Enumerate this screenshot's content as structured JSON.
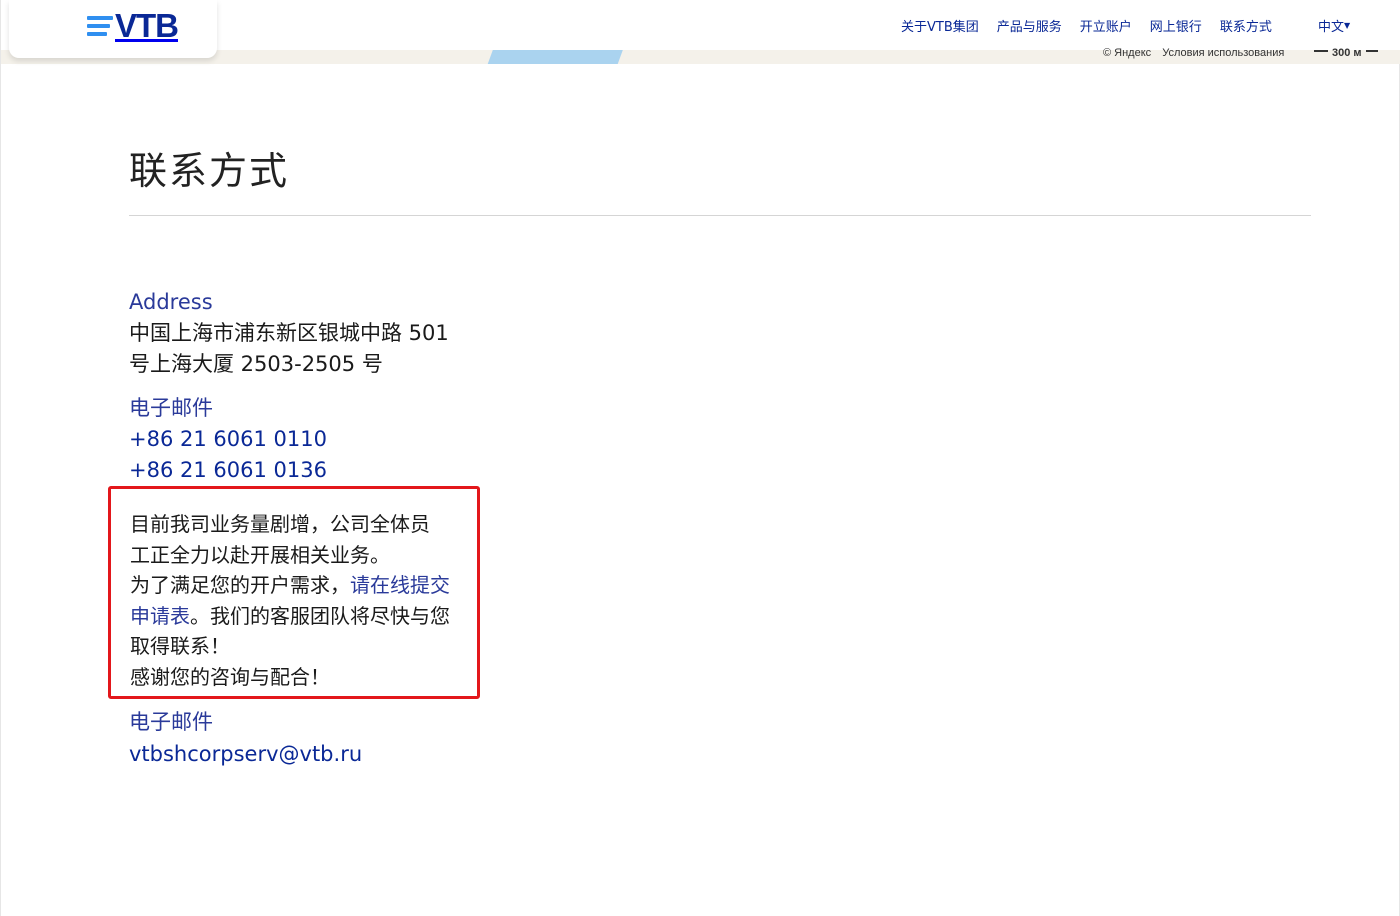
{
  "header": {
    "logo_text": "VTB",
    "nav": [
      "关于VTB集团",
      "产品与服务",
      "开立账户",
      "网上银行",
      "联系方式"
    ],
    "language": "中文",
    "map_attribution": "© Яндекс",
    "map_terms": "Условия использования",
    "map_scale": "300 м"
  },
  "page": {
    "title": "联系方式"
  },
  "contact": {
    "address_label": "Address",
    "address_line1": "中国上海市浦东新区银城中路 501",
    "address_line2": "号上海大厦 2503-2505 号",
    "phone_label": "电子邮件",
    "phones": [
      "+86 21 6061 0110",
      "+86 21 6061 0136"
    ],
    "notice_line1": "目前我司业务量剧增，公司全体员",
    "notice_line2": "工正全力以赴开展相关业务。",
    "notice_line3_pre": "为了满足您的开户需求，",
    "notice_link": "请在线提交申请表",
    "notice_line3_post": "。我们的客服团队将尽快与您取得联系！",
    "notice_line_last": "感谢您的咨询与配合！",
    "email_label": "电子邮件",
    "email": "vtbshcorpserv@vtb.ru"
  },
  "colors": {
    "brand_blue": "#0a2896",
    "logo_stripes": "#2f8ff0",
    "highlight_box": "#e3171b"
  }
}
